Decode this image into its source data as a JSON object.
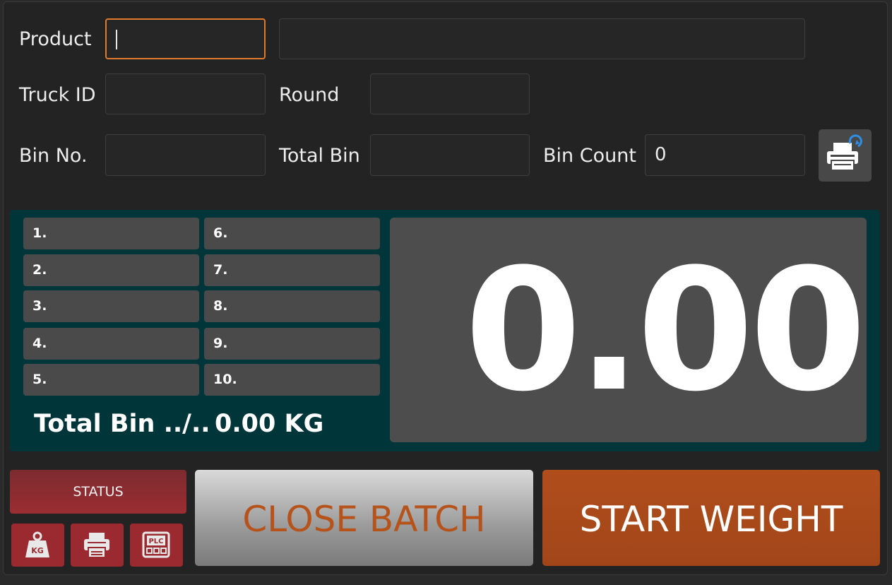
{
  "form": {
    "product_label": "Product",
    "product_code": "",
    "product_name": "",
    "truck_id_label": "Truck ID",
    "truck_id": "",
    "round_label": "Round",
    "round": "",
    "bin_no_label": "Bin No.",
    "bin_no": "",
    "total_bin_label": "Total Bin",
    "total_bin": "",
    "bin_count_label": "Bin Count",
    "bin_count": "0"
  },
  "bins": {
    "left": [
      "1.",
      "2.",
      "3.",
      "4.",
      "5."
    ],
    "right": [
      "6.",
      "7.",
      "8.",
      "9.",
      "10."
    ]
  },
  "summary": {
    "total_bin_text": "Total Bin ../..",
    "total_kg_text": "0.00 KG"
  },
  "display": {
    "weight": "0.00"
  },
  "controls": {
    "status_label": "STATUS",
    "close_batch_label": "CLOSE BATCH",
    "start_weight_label": "START WEIGHT"
  },
  "icons": {
    "printer_refresh": "printer-refresh-icon",
    "scale": "kg-weight-icon",
    "printer": "printer-icon",
    "plc": "plc-icon"
  },
  "colors": {
    "accent_orange": "#b04d1b",
    "focus_border": "#e07a2c",
    "panel_teal": "#00363a",
    "status_red": "#9b2a30"
  }
}
